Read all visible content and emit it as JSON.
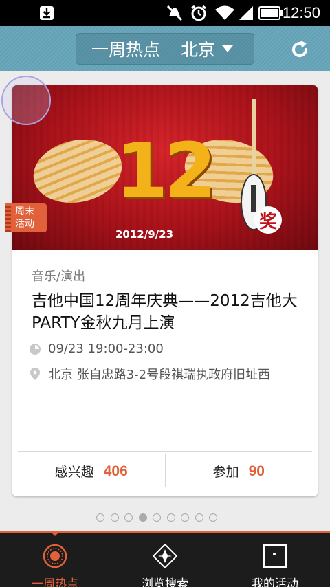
{
  "status_bar": {
    "time": "12:50",
    "icons": [
      "download-icon",
      "muted-icon",
      "alarm-icon",
      "wifi-icon",
      "signal-icon",
      "battery-icon"
    ]
  },
  "header": {
    "title": "一周热点",
    "city": "北京",
    "refresh_icon": "refresh-icon"
  },
  "card": {
    "tag": "周末活动",
    "tag_line1": "周末",
    "tag_line2": "活动",
    "poster": {
      "big_number": "12",
      "date_text": "2012/9/23",
      "badge": "奖"
    },
    "category": "音乐/演出",
    "title": "吉他中国12周年庆典——2012吉他大PARTY金秋九月上演",
    "time": "09/23 19:00-23:00",
    "address": "北京 张自忠路3-2号段祺瑞执政府旧址西",
    "interested_label": "感兴趣",
    "interested_count": "406",
    "join_label": "参加",
    "join_count": "90"
  },
  "pager": {
    "total": 9,
    "active_index": 3
  },
  "nav": {
    "items": [
      {
        "label": "一周热点",
        "icon": "hot-icon",
        "active": true
      },
      {
        "label": "浏览搜索",
        "icon": "compass-icon",
        "active": false
      },
      {
        "label": "我的活动",
        "icon": "my-activity-icon",
        "active": false
      }
    ]
  },
  "colors": {
    "accent": "#e0613a",
    "header": "#67a4b8",
    "nav_bg": "#1c1c1c"
  }
}
